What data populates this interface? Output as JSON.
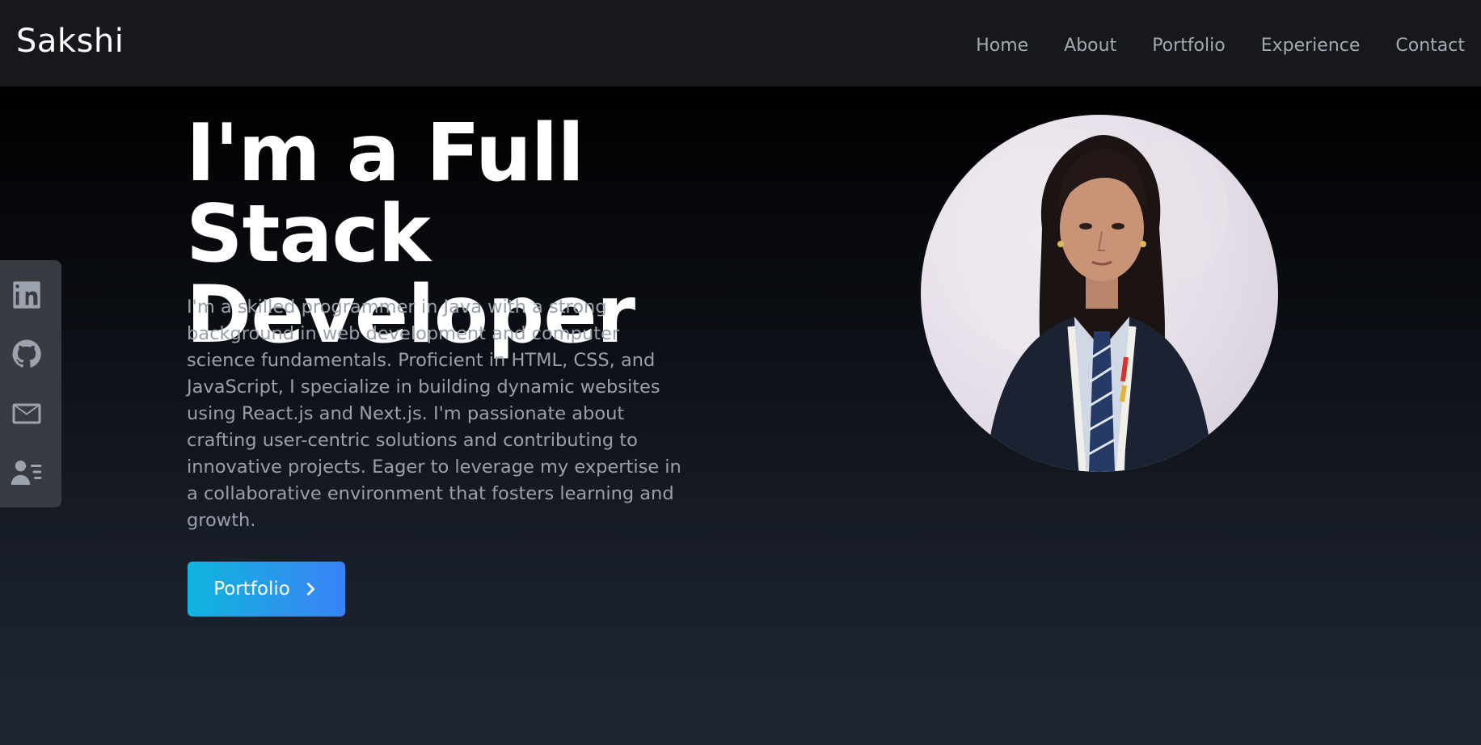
{
  "brand": {
    "name": "Sakshi"
  },
  "nav": {
    "items": [
      {
        "label": "Home"
      },
      {
        "label": "About"
      },
      {
        "label": "Portfolio"
      },
      {
        "label": "Experience"
      },
      {
        "label": "Contact"
      }
    ]
  },
  "social": [
    {
      "icon": "linkedin-icon"
    },
    {
      "icon": "github-icon"
    },
    {
      "icon": "mail-icon"
    },
    {
      "icon": "resume-icon"
    }
  ],
  "hero": {
    "title_line1": "I'm a Full Stack",
    "title_line2": "Developer",
    "description": "I'm a skilled programmer in Java with a strong background in web development and computer science fundamentals. Proficient in HTML, CSS, and JavaScript, I specialize in building dynamic websites using React.js and Next.js. I'm passionate about crafting user-centric solutions and contributing to innovative projects. Eager to leverage my expertise in a collaborative environment that fosters learning and growth.",
    "cta_label": "Portfolio",
    "cta_icon": "chevron-right-icon"
  },
  "colors": {
    "nav_bg": "#17181c",
    "cta_start": "#0fb5dd",
    "cta_end": "#3b82f6",
    "muted_text": "#9aa0ab"
  }
}
